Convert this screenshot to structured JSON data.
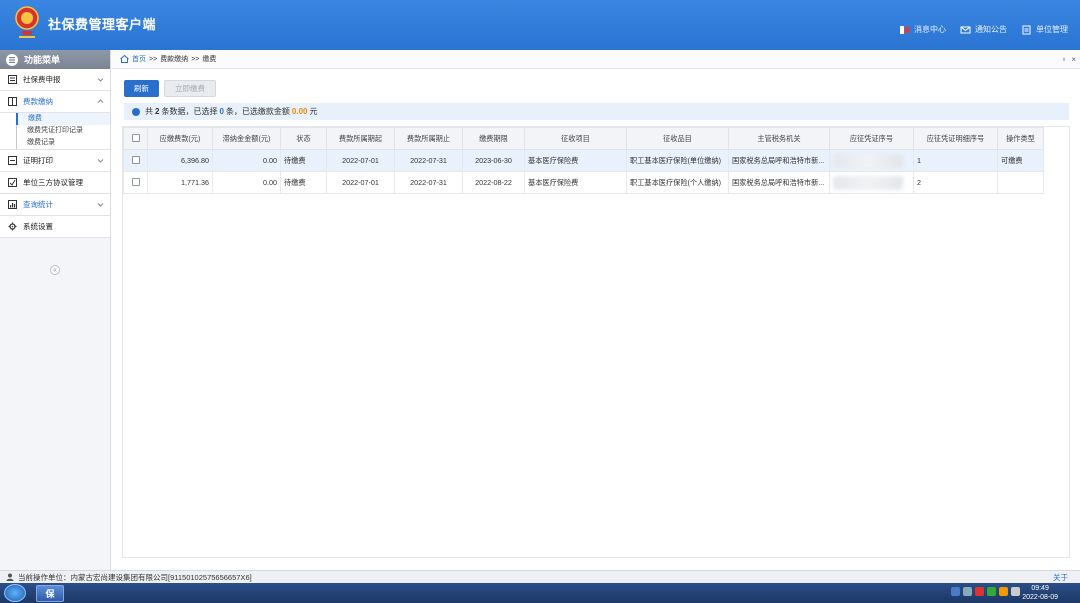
{
  "header": {
    "app_title": "社保费管理客户端",
    "links": [
      {
        "label": "消息中心",
        "icon": "message-icon"
      },
      {
        "label": "通知公告",
        "icon": "mail-icon"
      },
      {
        "label": "单位管理",
        "icon": "document-icon"
      }
    ]
  },
  "sidebar": {
    "title": "功能菜单",
    "items": [
      {
        "label": "社保费申报"
      },
      {
        "label": "费款缴纳"
      },
      {
        "label": "证明打印"
      },
      {
        "label": "单位三方协议管理"
      },
      {
        "label": "查询统计"
      },
      {
        "label": "系统设置"
      }
    ],
    "sub_items": [
      "缴费",
      "缴费凭证打印记录",
      "缴费记录"
    ],
    "collapse_glyph": "«"
  },
  "breadcrumb": {
    "home": "首页",
    "sep": ">>",
    "level1": "费款缴纳",
    "level2": "缴费"
  },
  "toolbar": {
    "refresh_label": "刷新",
    "pay_now_label": "立即缴费"
  },
  "summary": {
    "prefix": "共",
    "count": "2",
    "mid1": "条数据，已选择",
    "selected": "0",
    "mid2": "条，已选缴款金额",
    "amount": "0.00",
    "unit": "元"
  },
  "table": {
    "columns": [
      "应缴费款(元)",
      "滞纳金金额(元)",
      "状态",
      "费款所属期起",
      "费款所属期止",
      "缴费期限",
      "征收项目",
      "征收品目",
      "主管税务机关",
      "应征凭证序号",
      "应征凭证明细序号",
      "操作类型"
    ],
    "rows": [
      {
        "amount": "6,396.80",
        "late_fee": "0.00",
        "status": "待缴费",
        "start": "2022-07-01",
        "end": "2022-07-31",
        "deadline": "2023-06-30",
        "item": "基本医疗保险费",
        "subitem": "职工基本医疗保险(单位缴纳)",
        "authority": "国家税务总局呼和浩特市新...",
        "voucher": "",
        "detail": "1",
        "op": "可缴费"
      },
      {
        "amount": "1,771.36",
        "late_fee": "0.00",
        "status": "待缴费",
        "start": "2022-07-01",
        "end": "2022-07-31",
        "deadline": "2022-08-22",
        "item": "基本医疗保险费",
        "subitem": "职工基本医疗保险(个人缴纳)",
        "authority": "国家税务总局呼和浩特市新...",
        "voucher": "",
        "detail": "2",
        "op": ""
      }
    ]
  },
  "statusbar": {
    "label": "当前操作单位：内蒙古宏尚建设集团有限公司[91150102575656657X6]",
    "about": "关于"
  },
  "taskbar": {
    "app_glyph": "保",
    "time": "09:49",
    "date": "2022-08-09"
  },
  "colors": {
    "header_blue": "#2a74d3",
    "accent": "#2a6fcc",
    "amount_orange": "#f08a00"
  }
}
